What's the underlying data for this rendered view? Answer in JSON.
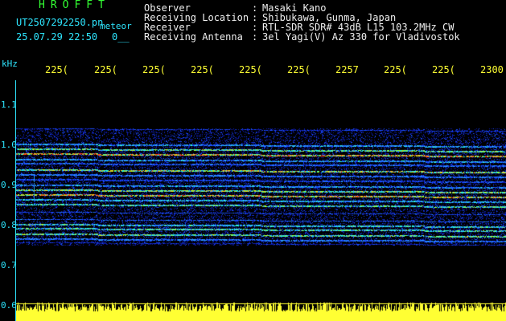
{
  "header": {
    "title": "HROFFT",
    "filename": "UT2507292250.pn",
    "mode": "meteor",
    "datetime": "25.07.29 22:50",
    "count": "0__"
  },
  "info": {
    "rows": [
      {
        "label": "Observer",
        "colon": ":",
        "value": "Masaki Kano"
      },
      {
        "label": "Receiving Location",
        "colon": ":",
        "value": "Shibukawa, Gunma, Japan"
      },
      {
        "label": "Receiver",
        "colon": ":",
        "value": "RTL-SDR SDR# 43dB L15 103.2MHz CW"
      },
      {
        "label": "Receiving Antenna",
        "colon": ":",
        "value": "3el Yagi(V) Az 330 for Vladivostok"
      }
    ]
  },
  "axes": {
    "y_unit": "kHz",
    "x_ticks": [
      "225(",
      "225(",
      "225(",
      "225(",
      "225(",
      "225(",
      "2257",
      "225(",
      "225(",
      "2300"
    ],
    "y_ticks": [
      "1.1",
      "1.0",
      "0.9",
      "0.8",
      "0.7",
      "0.6"
    ]
  },
  "colors": {
    "title": "#33ff33",
    "text": "#2ee6ff",
    "axis": "#2ee6ff",
    "noise_floor": "#ffff33",
    "background": "#000000"
  }
}
